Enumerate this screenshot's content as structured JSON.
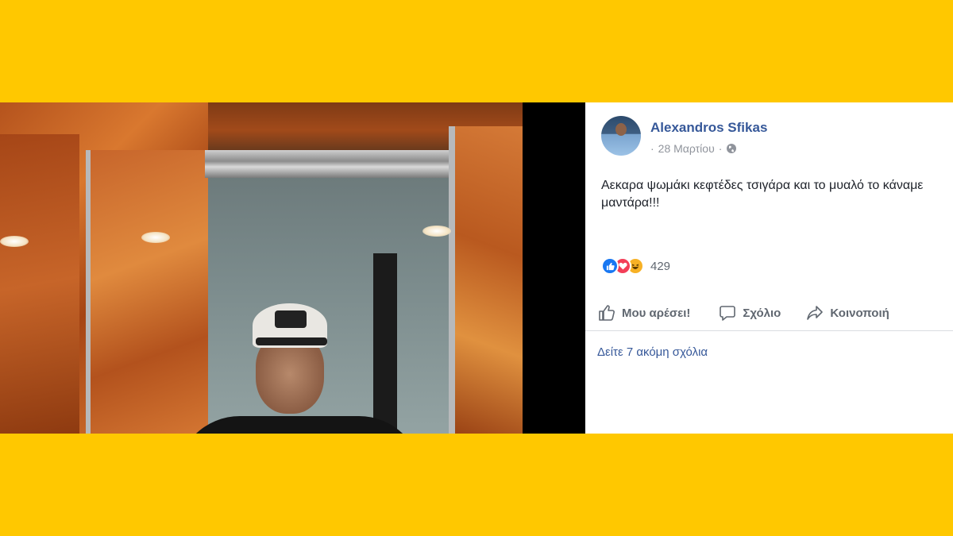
{
  "post": {
    "author": "Alexandros Sfikas",
    "date": "28 Μαρτίου",
    "privacy_icon": "globe-icon",
    "text": "Αεκαρα ψωμάκι κεφτέδες τσιγάρα και το μυαλό το κάναμε μαντάρα!!!",
    "reactions": {
      "icons": [
        "like-icon",
        "love-icon",
        "haha-icon"
      ],
      "count": "429"
    },
    "actions": {
      "like_label": "Μου αρέσει!",
      "comment_label": "Σχόλιο",
      "share_label": "Κοινοποιή"
    },
    "more_comments": "Δείτε 7 ακόμη σχόλια"
  },
  "colors": {
    "background": "#FFC800",
    "author_link": "#365899",
    "meta_text": "#90949c",
    "like_blue": "#1877f2",
    "love_red": "#f33e58",
    "haha_yellow": "#f7b125"
  }
}
